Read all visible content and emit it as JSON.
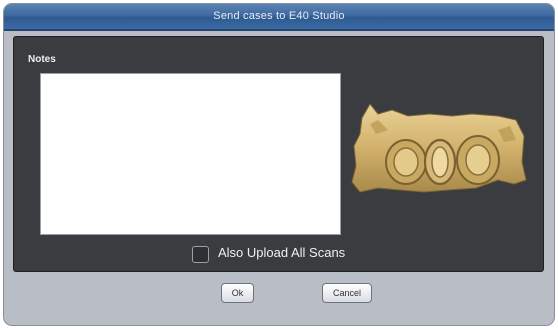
{
  "window": {
    "title": "Send cases to E40 Studio"
  },
  "notes": {
    "label": "Notes",
    "value": ""
  },
  "options": {
    "upload_all_scans_label": "Also Upload All Scans",
    "upload_all_scans_checked": false
  },
  "buttons": {
    "ok": "Ok",
    "cancel": "Cancel"
  },
  "colors": {
    "titlebar": "#3f6aa0",
    "panel": "#3a3c40",
    "dialog": "#b9bec6",
    "model": "#d8bc7a"
  },
  "image": {
    "icon": "dental-model-scan-image"
  }
}
